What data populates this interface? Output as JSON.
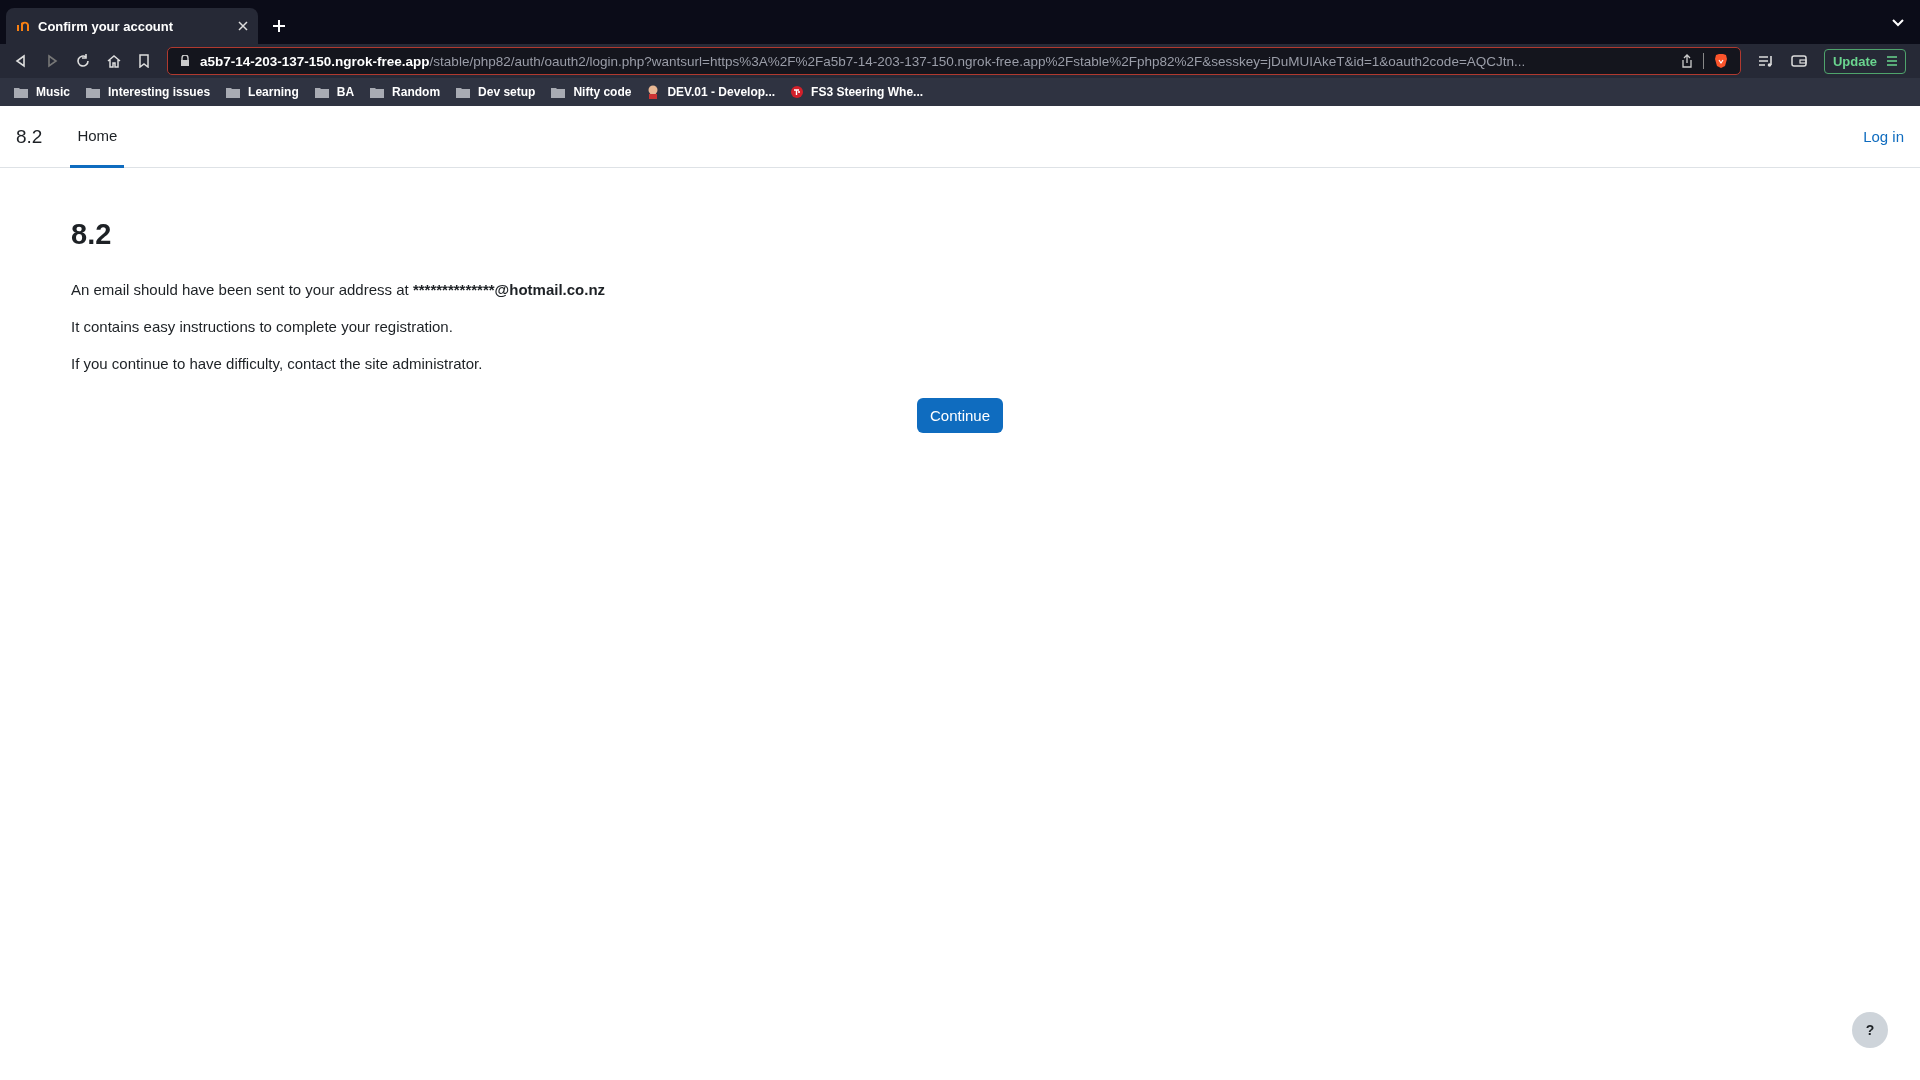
{
  "browser": {
    "tabs": [
      {
        "title": "Confirm your account",
        "selected": true
      }
    ],
    "url_host": "a5b7-14-203-137-150.ngrok-free.app",
    "url_path": "/stable/php82/auth/oauth2/login.php?wantsurl=https%3A%2F%2Fa5b7-14-203-137-150.ngrok-free.app%2Fstable%2Fphp82%2F&sesskey=jDuMUIAkeT&id=1&oauth2code=AQCJtn...",
    "update_button": "Update",
    "bookmarks": [
      {
        "label": "Music",
        "kind": "folder"
      },
      {
        "label": "Interesting issues",
        "kind": "folder"
      },
      {
        "label": "Learning",
        "kind": "folder"
      },
      {
        "label": "BA",
        "kind": "folder"
      },
      {
        "label": "Random",
        "kind": "folder"
      },
      {
        "label": "Dev setup",
        "kind": "folder"
      },
      {
        "label": "Nifty code",
        "kind": "folder"
      },
      {
        "label": "DEV.01 - Develop...",
        "kind": "site"
      },
      {
        "label": "FS3 Steering Whe...",
        "kind": "logo"
      }
    ]
  },
  "site": {
    "brand": "8.2",
    "nav": [
      {
        "label": "Home",
        "selected": true
      }
    ],
    "login": "Log in"
  },
  "page": {
    "heading": "8.2",
    "email_sentence": {
      "text": "An email should have been sent to your address at ",
      "email": "**************@hotmail.co.nz"
    },
    "paragraphs": [
      "It contains easy instructions to complete your registration.",
      "If you continue to have difficulty, contact the site administrator."
    ],
    "continue_button": "Continue"
  },
  "help_button": "?"
}
